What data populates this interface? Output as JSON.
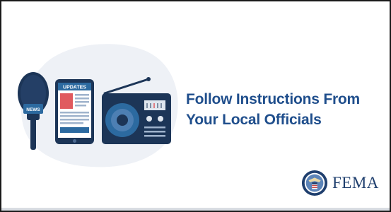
{
  "slide": {
    "headline_line1": "Follow Instructions From",
    "headline_line2": "Your Local Officials"
  },
  "illustration": {
    "phone_header_text": "UPDATES",
    "microphone_flag_text": "NEWS"
  },
  "brand": {
    "logo_text": "FEMA"
  },
  "colors": {
    "headline": "#1f4e8c",
    "navy": "#1c3557",
    "blob": "#eef1f6",
    "accent_red": "#e05a5f"
  }
}
